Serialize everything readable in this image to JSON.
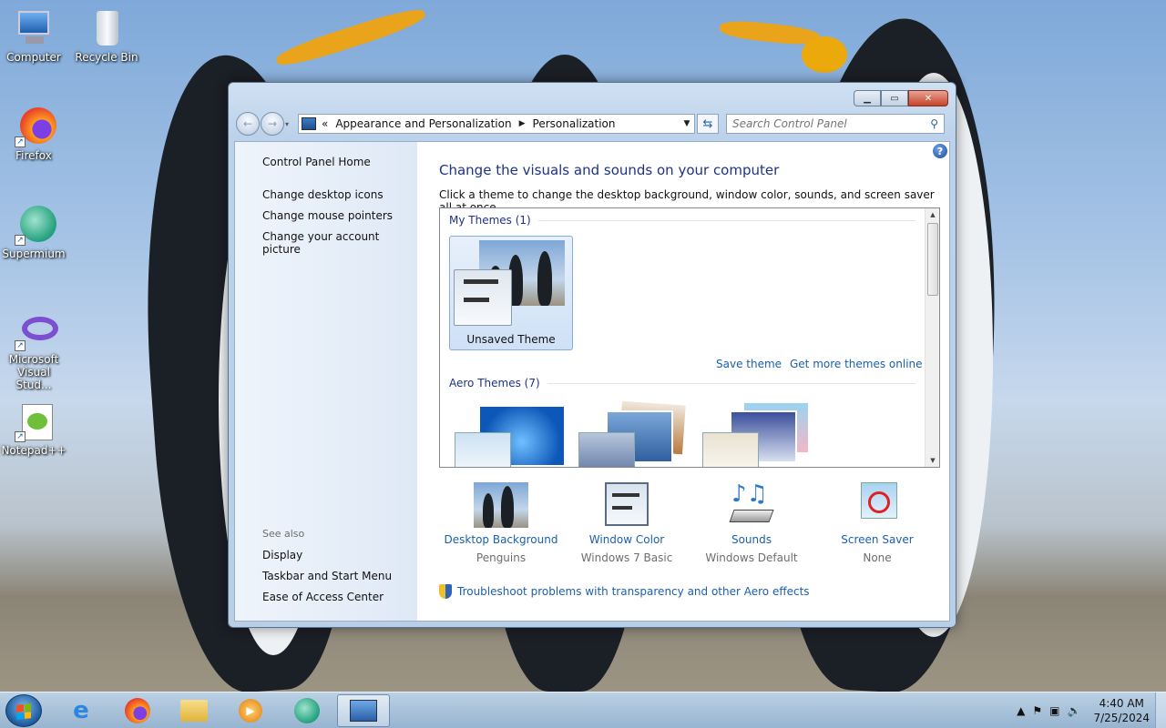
{
  "desktop": {
    "icons": [
      {
        "label": "Computer",
        "icon": "computer-icon"
      },
      {
        "label": "Recycle Bin",
        "icon": "recycle-bin-icon"
      },
      {
        "label": "Firefox",
        "icon": "firefox-icon"
      },
      {
        "label": "Supermium",
        "icon": "supermium-icon"
      },
      {
        "label": "Microsoft Visual Stud...",
        "icon": "visual-studio-icon"
      },
      {
        "label": "Notepad++",
        "icon": "notepadpp-icon"
      }
    ]
  },
  "window": {
    "breadcrumb": {
      "overflow": "«",
      "items": [
        "Appearance and Personalization",
        "Personalization"
      ]
    },
    "search_placeholder": "Search Control Panel",
    "help_glyph": "?",
    "left_pane": {
      "home": "Control Panel Home",
      "links": [
        "Change desktop icons",
        "Change mouse pointers",
        "Change your account picture"
      ],
      "see_also_title": "See also",
      "see_also": [
        "Display",
        "Taskbar and Start Menu",
        "Ease of Access Center"
      ]
    },
    "main": {
      "title": "Change the visuals and sounds on your computer",
      "subtitle": "Click a theme to change the desktop background, window color, sounds, and screen saver all at once.",
      "my_themes_header": "My Themes (1)",
      "my_themes": [
        {
          "name": "Unsaved Theme",
          "selected": true
        }
      ],
      "save_theme": "Save theme",
      "get_more": "Get more themes online",
      "aero_header": "Aero Themes (7)"
    },
    "bottom": [
      {
        "label": "Desktop Background",
        "value": "Penguins",
        "icon": "desktop-background-icon"
      },
      {
        "label": "Window Color",
        "value": "Windows 7 Basic",
        "icon": "window-color-icon"
      },
      {
        "label": "Sounds",
        "value": "Windows Default",
        "icon": "sounds-icon"
      },
      {
        "label": "Screen Saver",
        "value": "None",
        "icon": "screen-saver-icon"
      }
    ],
    "troubleshoot": "Troubleshoot problems with transparency and other Aero effects"
  },
  "taskbar": {
    "apps": [
      "internet-explorer-icon",
      "firefox-icon",
      "file-explorer-icon",
      "media-player-icon",
      "supermium-icon",
      "control-panel-icon"
    ],
    "time": "4:40 AM",
    "date": "7/25/2024"
  },
  "colors": {
    "link": "#1b5fad",
    "heading": "#1e3287",
    "selection": "#cfe1f7"
  }
}
